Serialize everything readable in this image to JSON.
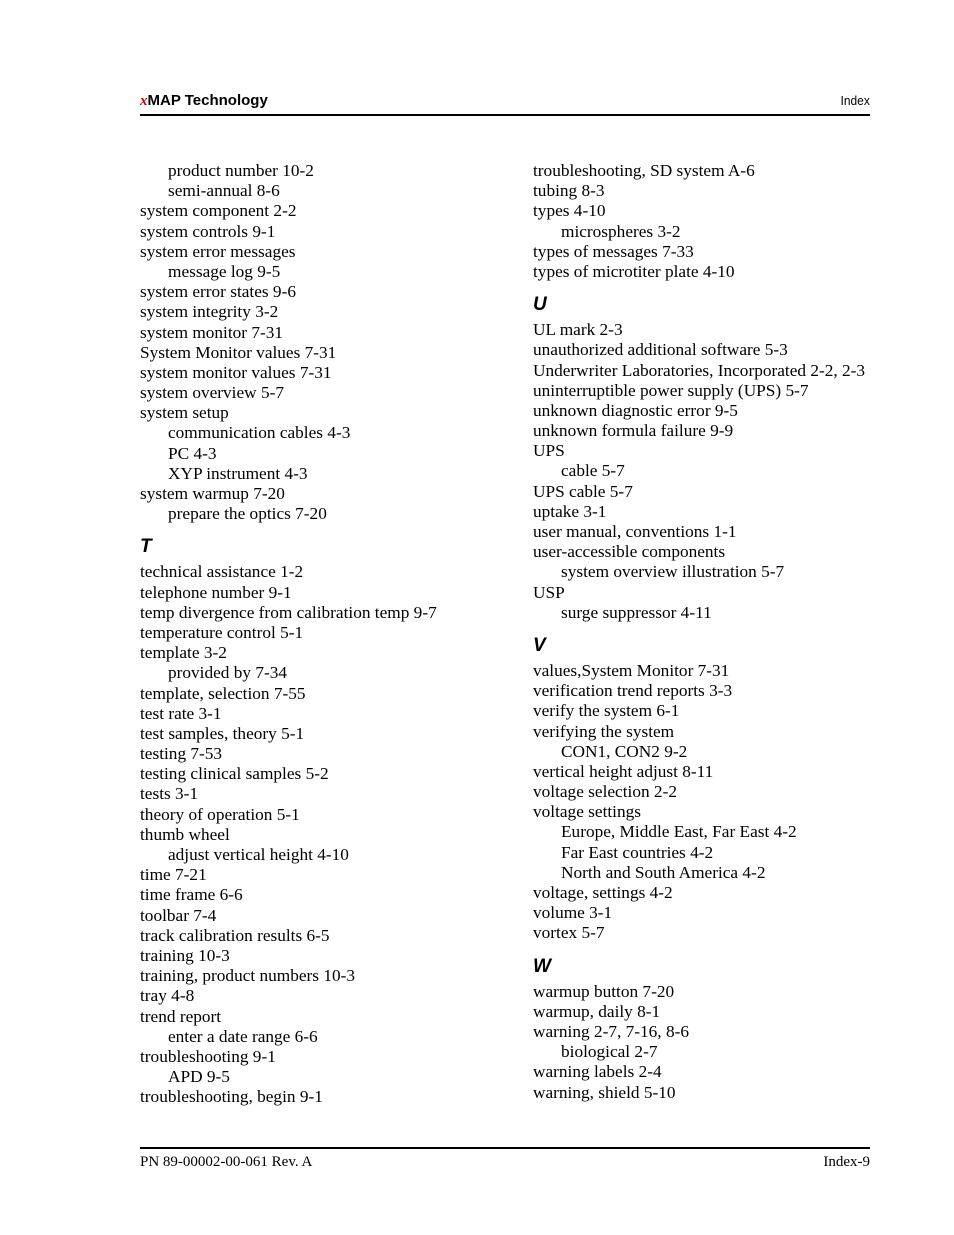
{
  "header": {
    "brand_prefix": "x",
    "brand_rest": "MAP Technology",
    "section": "Index"
  },
  "columns": [
    [
      {
        "type": "sub",
        "text": "product number 10-2"
      },
      {
        "type": "sub",
        "text": "semi-annual 8-6"
      },
      {
        "type": "entry",
        "text": "system component 2-2"
      },
      {
        "type": "entry",
        "text": "system controls 9-1"
      },
      {
        "type": "entry",
        "text": "system error messages"
      },
      {
        "type": "sub",
        "text": "message log 9-5"
      },
      {
        "type": "entry",
        "text": "system error states 9-6"
      },
      {
        "type": "entry",
        "text": "system integrity 3-2"
      },
      {
        "type": "entry",
        "text": "system monitor 7-31"
      },
      {
        "type": "entry",
        "text": "System Monitor values 7-31"
      },
      {
        "type": "entry",
        "text": "system monitor values 7-31"
      },
      {
        "type": "entry",
        "text": "system overview 5-7"
      },
      {
        "type": "entry",
        "text": "system setup"
      },
      {
        "type": "sub",
        "text": "communication cables 4-3"
      },
      {
        "type": "sub",
        "text": "PC 4-3"
      },
      {
        "type": "sub",
        "text": "XYP instrument 4-3"
      },
      {
        "type": "entry",
        "text": "system warmup 7-20"
      },
      {
        "type": "sub",
        "text": "prepare the optics 7-20"
      },
      {
        "type": "letter",
        "text": "T"
      },
      {
        "type": "entry",
        "text": "technical assistance 1-2"
      },
      {
        "type": "entry",
        "text": "telephone number 9-1"
      },
      {
        "type": "entry",
        "text": "temp divergence from calibration temp 9-7"
      },
      {
        "type": "entry",
        "text": "temperature control 5-1"
      },
      {
        "type": "entry",
        "text": "template 3-2"
      },
      {
        "type": "sub",
        "text": "provided by 7-34"
      },
      {
        "type": "entry",
        "text": "template, selection 7-55"
      },
      {
        "type": "entry",
        "text": "test rate 3-1"
      },
      {
        "type": "entry",
        "text": "test samples, theory 5-1"
      },
      {
        "type": "entry",
        "text": "testing 7-53"
      },
      {
        "type": "entry",
        "text": "testing clinical samples 5-2"
      },
      {
        "type": "entry",
        "text": "tests 3-1"
      },
      {
        "type": "entry",
        "text": "theory of operation 5-1"
      },
      {
        "type": "entry",
        "text": "thumb wheel"
      },
      {
        "type": "sub",
        "text": "adjust vertical height 4-10"
      },
      {
        "type": "entry",
        "text": "time 7-21"
      },
      {
        "type": "entry",
        "text": "time frame 6-6"
      },
      {
        "type": "entry",
        "text": "toolbar 7-4"
      },
      {
        "type": "entry",
        "text": "track calibration results 6-5"
      },
      {
        "type": "entry",
        "text": "training 10-3"
      },
      {
        "type": "entry",
        "text": "training, product numbers 10-3"
      },
      {
        "type": "entry",
        "text": "tray 4-8"
      },
      {
        "type": "entry",
        "text": "trend report"
      },
      {
        "type": "sub",
        "text": "enter a date range 6-6"
      },
      {
        "type": "entry",
        "text": "troubleshooting 9-1"
      },
      {
        "type": "sub",
        "text": "APD 9-5"
      },
      {
        "type": "entry",
        "text": "troubleshooting, begin 9-1"
      }
    ],
    [
      {
        "type": "entry",
        "text": "troubleshooting, SD system A-6"
      },
      {
        "type": "entry",
        "text": "tubing 8-3"
      },
      {
        "type": "entry",
        "text": "types 4-10"
      },
      {
        "type": "sub",
        "text": "microspheres 3-2"
      },
      {
        "type": "entry",
        "text": "types of messages 7-33"
      },
      {
        "type": "entry",
        "text": "types of microtiter plate 4-10"
      },
      {
        "type": "letter",
        "text": "U"
      },
      {
        "type": "entry",
        "text": "UL mark 2-3"
      },
      {
        "type": "entry",
        "text": "unauthorized additional software 5-3"
      },
      {
        "type": "entry",
        "text": "Underwriter Laboratories, Incorporated 2-2, 2-3"
      },
      {
        "type": "entry",
        "text": "uninterruptible power supply (UPS) 5-7"
      },
      {
        "type": "entry",
        "text": "unknown diagnostic error 9-5"
      },
      {
        "type": "entry",
        "text": "unknown formula failure 9-9"
      },
      {
        "type": "entry",
        "text": "UPS"
      },
      {
        "type": "sub",
        "text": "cable 5-7"
      },
      {
        "type": "entry",
        "text": "UPS cable 5-7"
      },
      {
        "type": "entry",
        "text": "uptake 3-1"
      },
      {
        "type": "entry",
        "text": "user manual, conventions 1-1"
      },
      {
        "type": "entry",
        "text": "user-accessible components"
      },
      {
        "type": "sub",
        "text": "system overview illustration 5-7"
      },
      {
        "type": "entry",
        "text": "USP"
      },
      {
        "type": "sub",
        "text": "surge suppressor 4-11"
      },
      {
        "type": "letter",
        "text": "V"
      },
      {
        "type": "entry",
        "text": "values,System Monitor 7-31"
      },
      {
        "type": "entry",
        "text": "verification trend reports 3-3"
      },
      {
        "type": "entry",
        "text": "verify the system 6-1"
      },
      {
        "type": "entry",
        "text": "verifying the system"
      },
      {
        "type": "sub",
        "text": "CON1, CON2 9-2"
      },
      {
        "type": "entry",
        "text": "vertical height adjust 8-11"
      },
      {
        "type": "entry",
        "text": "voltage selection 2-2"
      },
      {
        "type": "entry",
        "text": "voltage settings"
      },
      {
        "type": "sub",
        "text": "Europe, Middle East, Far East 4-2"
      },
      {
        "type": "sub",
        "text": "Far East countries 4-2"
      },
      {
        "type": "sub",
        "text": "North and South America 4-2"
      },
      {
        "type": "entry",
        "text": "voltage, settings 4-2"
      },
      {
        "type": "entry",
        "text": "volume 3-1"
      },
      {
        "type": "entry",
        "text": "vortex 5-7"
      },
      {
        "type": "letter",
        "text": "W"
      },
      {
        "type": "entry",
        "text": "warmup button 7-20"
      },
      {
        "type": "entry",
        "text": "warmup, daily 8-1"
      },
      {
        "type": "entry",
        "text": "warning 2-7, 7-16, 8-6"
      },
      {
        "type": "sub",
        "text": "biological 2-7"
      },
      {
        "type": "entry",
        "text": "warning labels 2-4"
      },
      {
        "type": "entry",
        "text": "warning, shield 5-10"
      }
    ]
  ],
  "footer": {
    "part_number": "PN 89-00002-00-061 Rev. A",
    "page_number": "Index-9"
  }
}
